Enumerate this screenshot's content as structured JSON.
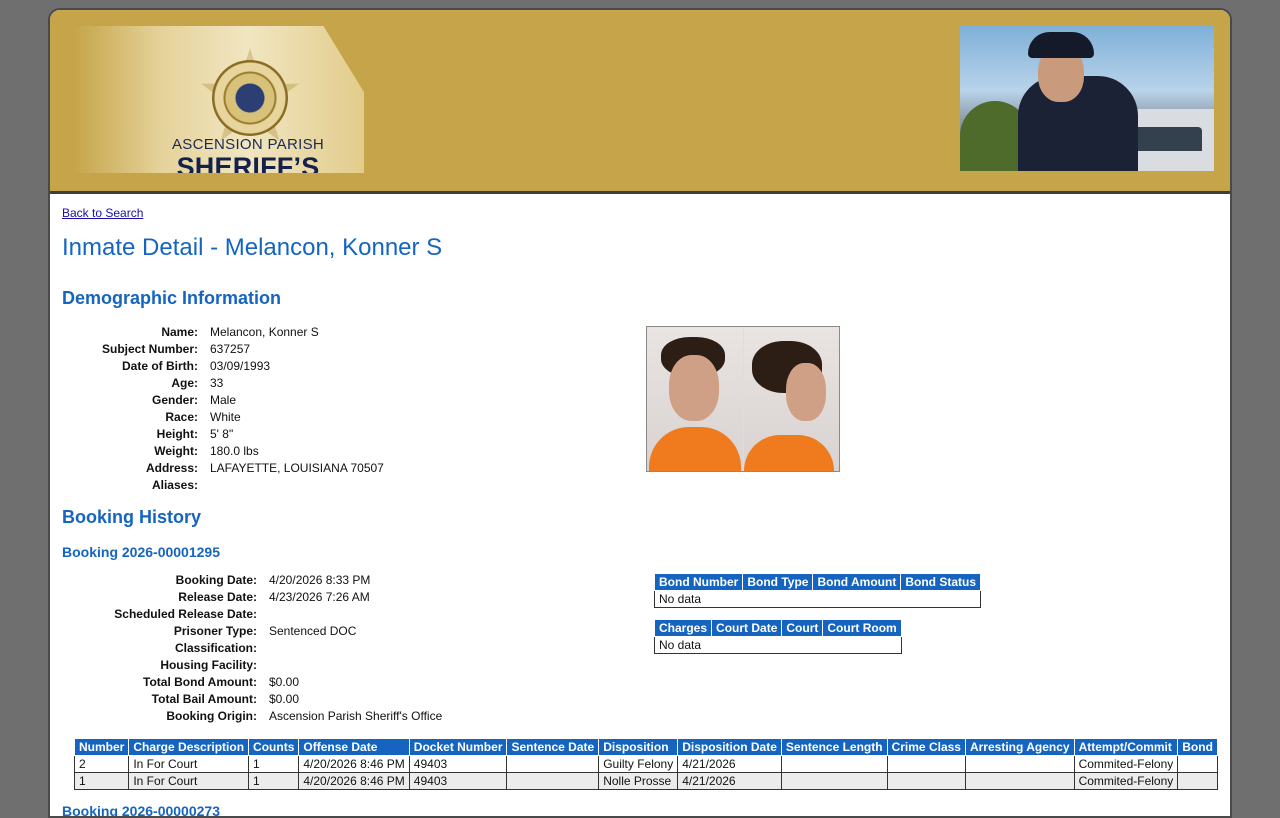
{
  "header": {
    "org_line1": "ASCENSION PARISH",
    "org_line2": "SHERIFF’S OFFICE",
    "badge_icon": "sheriff-badge-icon"
  },
  "nav": {
    "back_link": "Back to Search"
  },
  "page_title": "Inmate Detail - Melancon, Konner S",
  "demographics": {
    "heading": "Demographic Information",
    "fields": [
      {
        "label": "Name:",
        "value": "Melancon, Konner S"
      },
      {
        "label": "Subject Number:",
        "value": "637257"
      },
      {
        "label": "Date of Birth:",
        "value": "03/09/1993"
      },
      {
        "label": "Age:",
        "value": "33"
      },
      {
        "label": "Gender:",
        "value": "Male"
      },
      {
        "label": "Race:",
        "value": "White"
      },
      {
        "label": "Height:",
        "value": "5' 8\""
      },
      {
        "label": "Weight:",
        "value": "180.0 lbs"
      },
      {
        "label": "Address:",
        "value": "LAFAYETTE, LOUISIANA 70507"
      },
      {
        "label": "Aliases:",
        "value": ""
      }
    ]
  },
  "booking_history": {
    "heading": "Booking History",
    "booking": {
      "title": "Booking 2026-00001295",
      "fields": [
        {
          "label": "Booking Date:",
          "value": "4/20/2026 8:33 PM"
        },
        {
          "label": "Release Date:",
          "value": "4/23/2026 7:26 AM"
        },
        {
          "label": "Scheduled Release Date:",
          "value": ""
        },
        {
          "label": "Prisoner Type:",
          "value": "Sentenced DOC"
        },
        {
          "label": "Classification:",
          "value": ""
        },
        {
          "label": "Housing Facility:",
          "value": ""
        },
        {
          "label": "Total Bond Amount:",
          "value": "$0.00"
        },
        {
          "label": "Total Bail Amount:",
          "value": "$0.00"
        },
        {
          "label": "Booking Origin:",
          "value": "Ascension Parish Sheriff's Office"
        }
      ],
      "bond_table": {
        "headers": [
          "Bond Number",
          "Bond Type",
          "Bond Amount",
          "Bond Status"
        ],
        "empty": "No data"
      },
      "court_table": {
        "headers": [
          "Charges",
          "Court Date",
          "Court",
          "Court Room"
        ],
        "empty": "No data"
      },
      "charges_table": {
        "headers": [
          "Number",
          "Charge Description",
          "Counts",
          "Offense Date",
          "Docket Number",
          "Sentence Date",
          "Disposition",
          "Disposition Date",
          "Sentence Length",
          "Crime Class",
          "Arresting Agency",
          "Attempt/Commit",
          "Bond"
        ],
        "rows": [
          [
            "2",
            "In For Court",
            "1",
            "4/20/2026 8:46 PM",
            "49403",
            "",
            "Guilty Felony",
            "4/21/2026",
            "",
            "",
            "",
            "Commited-Felony",
            ""
          ],
          [
            "1",
            "In For Court",
            "1",
            "4/20/2026 8:46 PM",
            "49403",
            "",
            "Nolle Prosse",
            "4/21/2026",
            "",
            "",
            "",
            "Commited-Felony",
            ""
          ]
        ]
      }
    },
    "next_booking_title": "Booking 2026-00000273"
  }
}
